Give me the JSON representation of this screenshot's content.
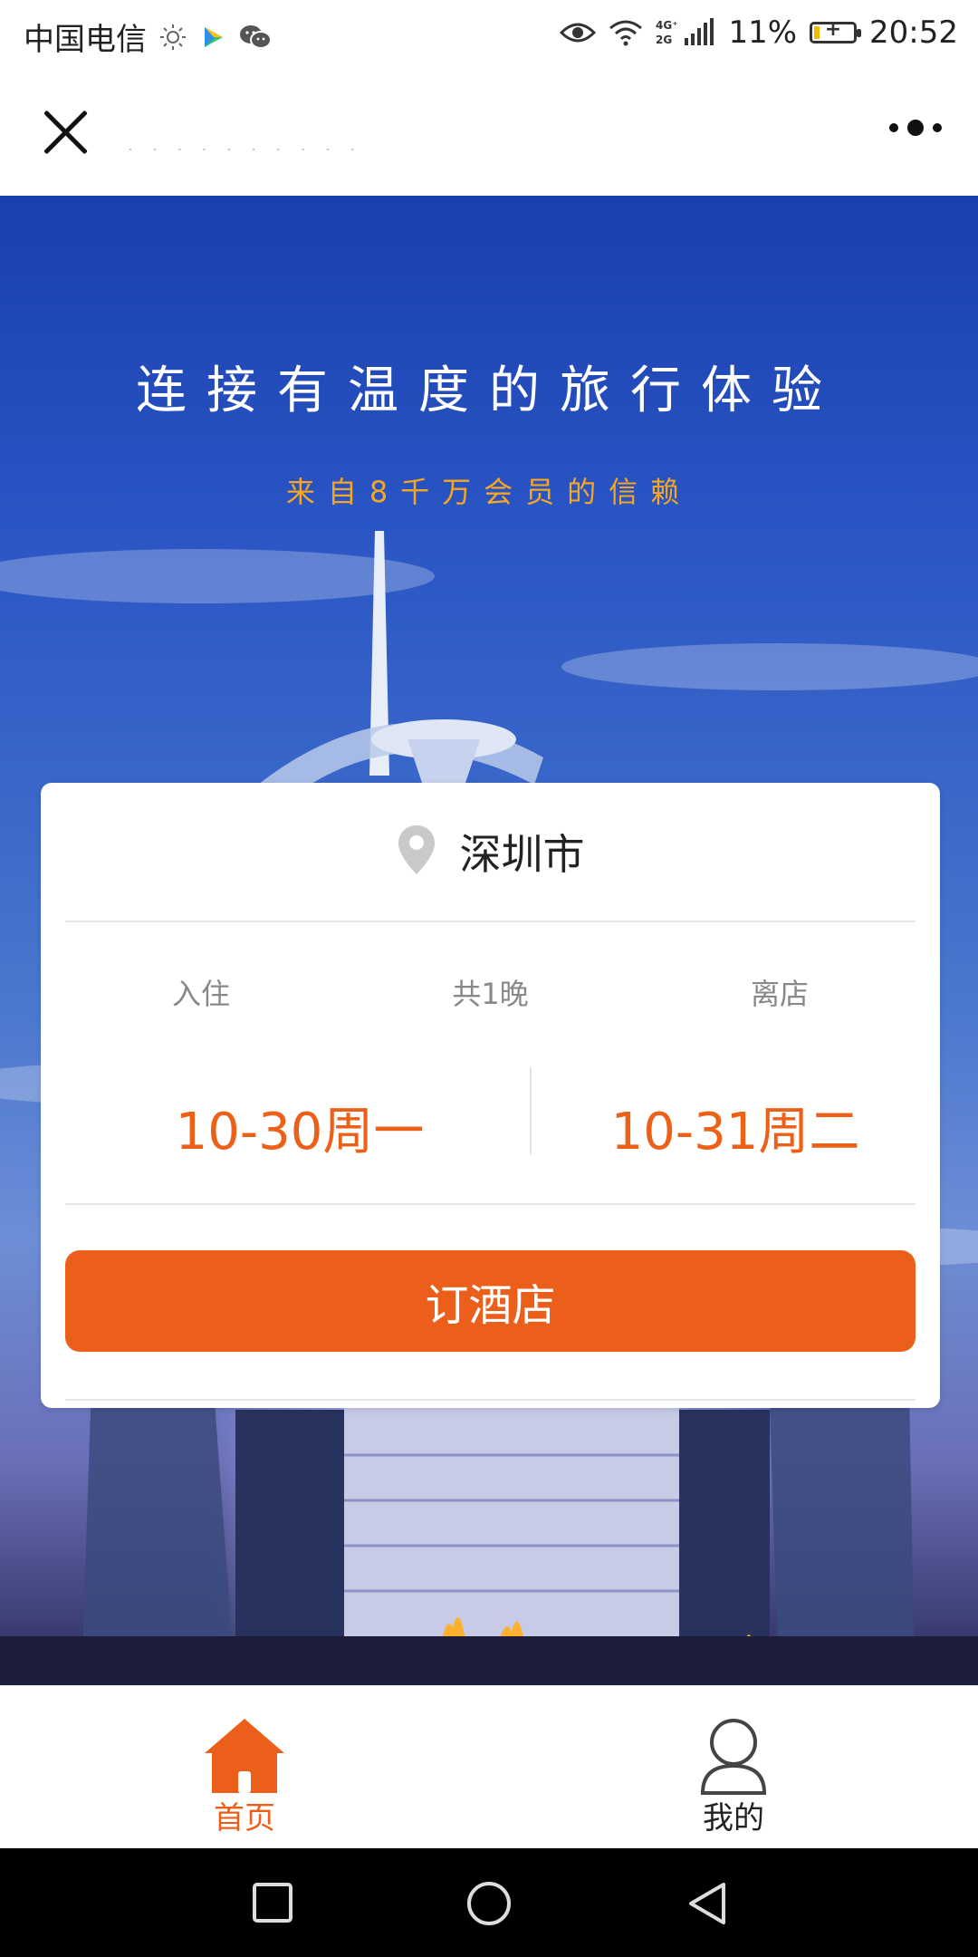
{
  "status_bar": {
    "carrier": "中国电信",
    "battery_percent": "11%",
    "time": "20:52",
    "network": "4G⁺ 2G",
    "icons": [
      "brightness-icon",
      "video-app-icon",
      "wechat-icon",
      "eye-icon",
      "wifi-icon",
      "signal-icon",
      "battery-charging-icon"
    ]
  },
  "nav": {
    "title": "· · · · · · · · · ·"
  },
  "hero": {
    "title": "连接有温度的旅行体验",
    "subtitle": "来自8千万会员的信赖"
  },
  "booking": {
    "city": "深圳市",
    "checkin_label": "入住",
    "nights_label": "共1晚",
    "checkout_label": "离店",
    "checkin_date": "10-30周一",
    "checkout_date": "10-31周二",
    "book_button": "订酒店"
  },
  "tabs": [
    {
      "label": "首页",
      "icon": "home-icon",
      "active": true
    },
    {
      "label": "我的",
      "icon": "user-icon",
      "active": false
    }
  ],
  "colors": {
    "accent": "#ec5f1a",
    "subtitle": "#f5a623",
    "hero_blue": "#2a55c4"
  }
}
